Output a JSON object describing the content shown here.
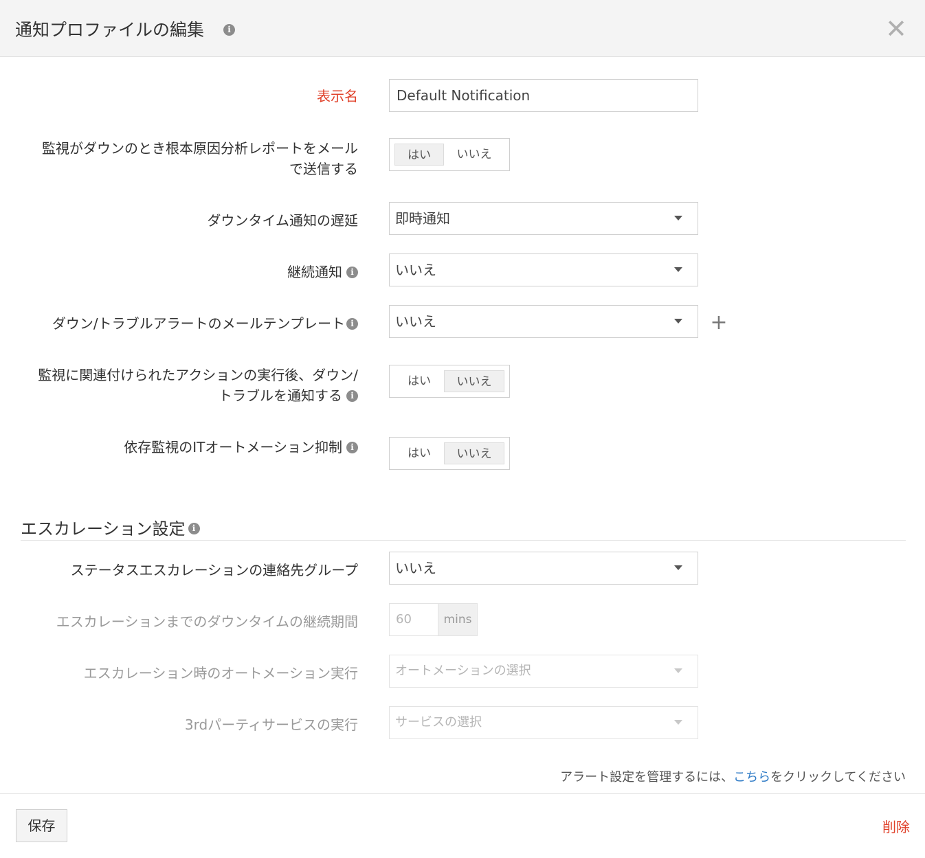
{
  "dialog": {
    "title": "通知プロファイルの編集",
    "info_icon": "i",
    "close_icon": "✕"
  },
  "fields": {
    "display_name": {
      "label": "表示名",
      "value": "Default Notification"
    },
    "rca_email": {
      "label_line1": "監視がダウンのとき根本原因分析レポートをメール",
      "label_line2": "で送信する",
      "yes": "はい",
      "no": "いいえ",
      "selected": "はい"
    },
    "downtime_delay": {
      "label": "ダウンタイム通知の遅延",
      "value": "即時通知"
    },
    "persistent": {
      "label": "継続通知",
      "value": "いいえ"
    },
    "mail_template": {
      "label": "ダウン/トラブルアラートのメールテンプレート",
      "value": "いいえ",
      "add_icon": "+"
    },
    "notify_after_action": {
      "label_line1": "監視に関連付けられたアクションの実行後、ダウン/",
      "label_line2": "トラブルを通知する",
      "yes": "はい",
      "no": "いいえ",
      "selected": "いいえ"
    },
    "suppress_dependent": {
      "label": "依存監視のITオートメーション抑制",
      "yes": "はい",
      "no": "いいえ",
      "selected": "いいえ"
    }
  },
  "escalation": {
    "section_title": "エスカレーション設定",
    "contact_group": {
      "label": "ステータスエスカレーションの連絡先グループ",
      "value": "いいえ"
    },
    "downtime_duration": {
      "label": "エスカレーションまでのダウンタイムの継続期間",
      "value": "60",
      "unit": "mins"
    },
    "automation": {
      "label": "エスカレーション時のオートメーション実行",
      "placeholder": "オートメーションの選択"
    },
    "third_party": {
      "label": "3rdパーティサービスの実行",
      "placeholder": "サービスの選択"
    }
  },
  "footnote": {
    "prefix": "アラート設定を管理するには、",
    "link": "こちら",
    "suffix": "をクリックしてください"
  },
  "footer": {
    "save_label": "保存",
    "delete_label": "削除"
  },
  "colors": {
    "required": "#e0412a",
    "link": "#2f7bc6",
    "header_bg": "#f4f4f4"
  }
}
